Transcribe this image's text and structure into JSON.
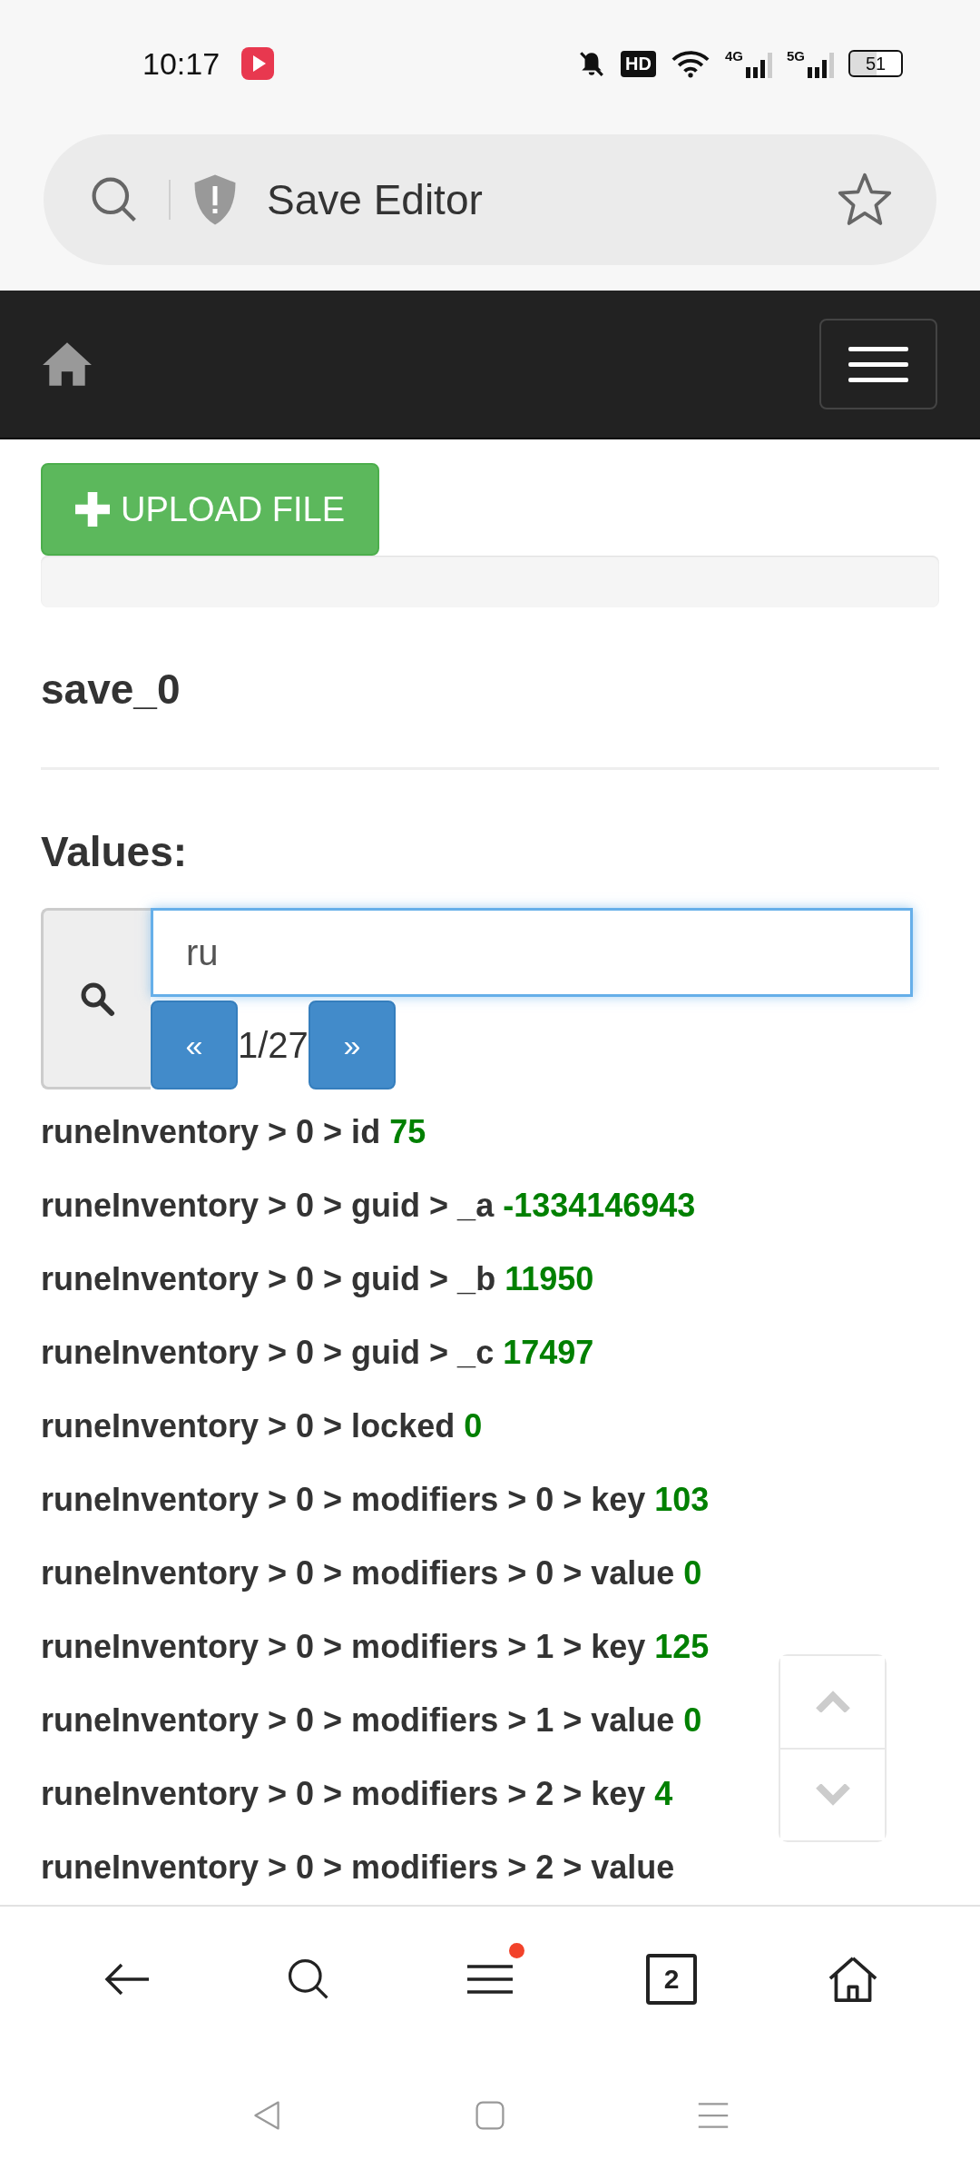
{
  "status_bar": {
    "time": "10:17",
    "hd": "HD",
    "network_1": "4G",
    "network_2": "5G",
    "battery": "51"
  },
  "address_bar": {
    "title": "Save Editor"
  },
  "upload_button": {
    "label": "UPLOAD FILE"
  },
  "file_name": "save_0",
  "values_heading": "Values:",
  "search": {
    "value": "ru",
    "prev": "«",
    "counter": "1/27",
    "next": "»"
  },
  "results": [
    {
      "path": "runeInventory > 0 > id",
      "value": "75"
    },
    {
      "path": "runeInventory > 0 > guid > _a",
      "value": "-1334146943"
    },
    {
      "path": "runeInventory > 0 > guid > _b",
      "value": "11950"
    },
    {
      "path": "runeInventory > 0 > guid > _c",
      "value": "17497"
    },
    {
      "path": "runeInventory > 0 > locked",
      "value": "0"
    },
    {
      "path": "runeInventory > 0 > modifiers > 0 > key",
      "value": "103"
    },
    {
      "path": "runeInventory > 0 > modifiers > 0 > value",
      "value": "0"
    },
    {
      "path": "runeInventory > 0 > modifiers > 1 > key",
      "value": "125"
    },
    {
      "path": "runeInventory > 0 > modifiers > 1 > value",
      "value": "0"
    },
    {
      "path": "runeInventory > 0 > modifiers > 2 > key",
      "value": "4"
    },
    {
      "path": "runeInventory > 0 > modifiers > 2 > value"
    }
  ],
  "bottom_nav": {
    "tab_count": "2",
    "menu_badge": true
  }
}
